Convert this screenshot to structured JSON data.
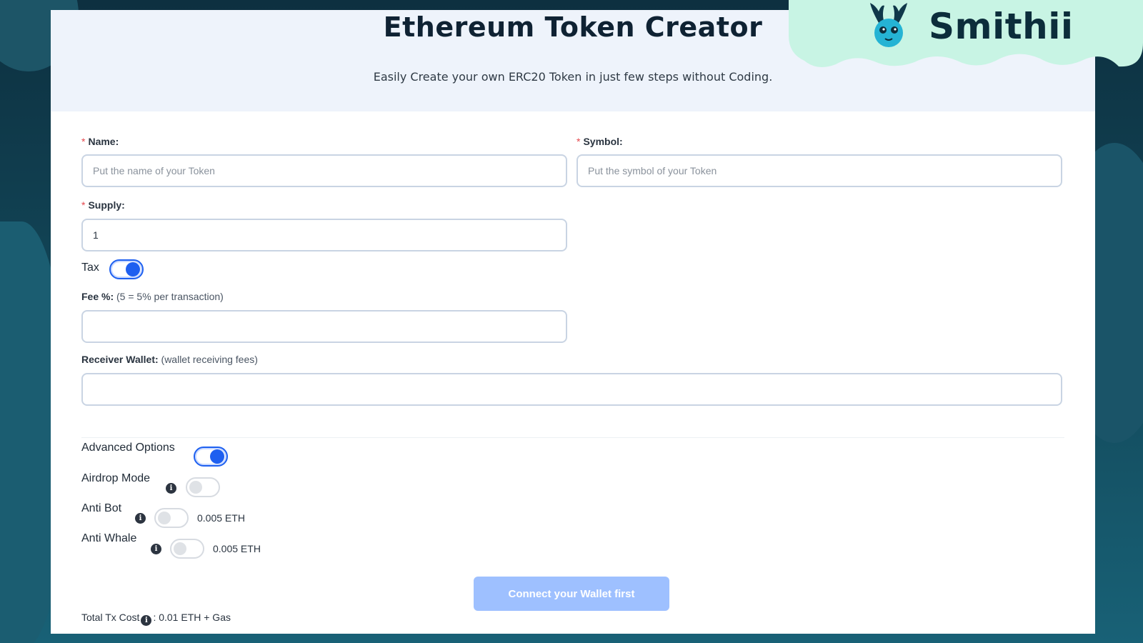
{
  "header": {
    "title": "Ethereum Token Creator",
    "subtitle": "Easily Create your own ERC20 Token in just few steps without Coding."
  },
  "brand": {
    "logo_text": "Smithii",
    "mascot_icon": "bunny-mascot-icon",
    "cloud_color": "#c8f4e4"
  },
  "form": {
    "name": {
      "required_mark": "*",
      "label": "Name:",
      "placeholder": "Put the name of your Token",
      "value": ""
    },
    "symbol": {
      "required_mark": "*",
      "label": "Symbol:",
      "placeholder": "Put the symbol of your Token",
      "value": ""
    },
    "supply": {
      "required_mark": "*",
      "label": "Supply:",
      "value": "1"
    },
    "tax": {
      "label": "Tax",
      "enabled": true
    },
    "fee": {
      "label": "Fee %:",
      "hint": "(5 = 5% per transaction)",
      "value": ""
    },
    "receiver": {
      "label": "Receiver Wallet:",
      "hint": "(wallet receiving fees)",
      "value": ""
    }
  },
  "advanced": {
    "label": "Advanced Options",
    "enabled": true,
    "options": [
      {
        "label": "Airdrop Mode",
        "info_icon": "info-icon",
        "enabled": false,
        "price": ""
      },
      {
        "label": "Anti Bot",
        "info_icon": "info-icon",
        "enabled": false,
        "price": "0.005 ETH"
      },
      {
        "label": "Anti Whale",
        "info_icon": "info-icon",
        "enabled": false,
        "price": "0.005 ETH"
      }
    ]
  },
  "actions": {
    "connect_label": "Connect your Wallet first"
  },
  "footer": {
    "total_label": "Total Tx Cost",
    "total_value": ": 0.01 ETH + Gas"
  },
  "colors": {
    "accent": "#1e5ff0",
    "button_disabled": "#9ec0ff",
    "required": "#e5484d",
    "header_bg": "#eef3fb"
  }
}
